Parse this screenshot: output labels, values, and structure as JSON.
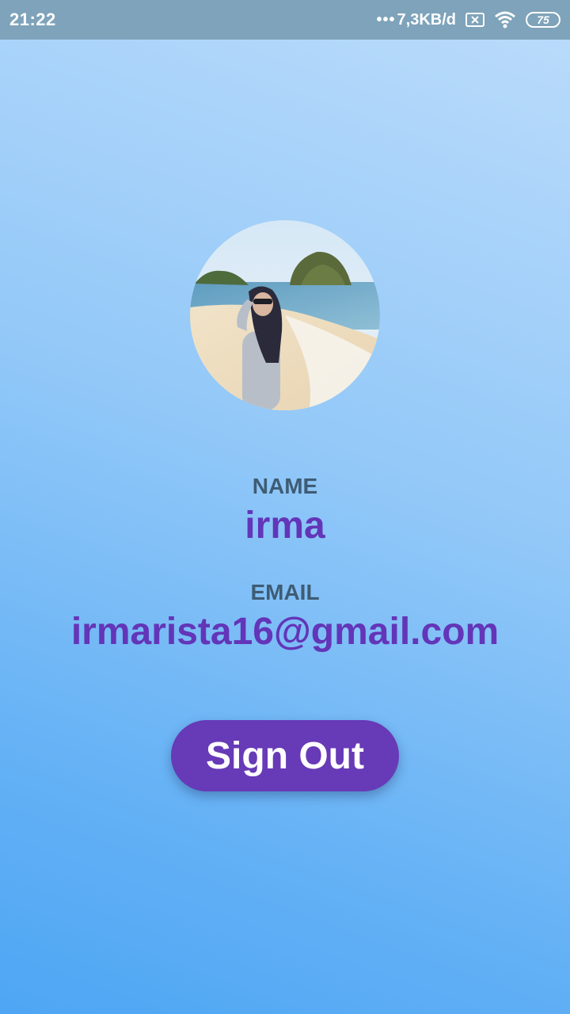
{
  "status_bar": {
    "time": "21:22",
    "dots": "•••",
    "network_speed": "7,3KB/d",
    "battery_level": "75",
    "icons": [
      "sim-off-icon",
      "wifi-icon",
      "battery-icon"
    ]
  },
  "profile": {
    "avatar_description": "profile-photo",
    "name_label": "NAME",
    "name_value": "irma",
    "email_label": "EMAIL",
    "email_value": "irmarista16@gmail.com"
  },
  "actions": {
    "sign_out_label": "Sign Out"
  },
  "colors": {
    "accent": "#673ab7",
    "value_text": "#6335b8",
    "label_text": "#3e5c74",
    "status_bar": "#7ea3ba",
    "background_top": "#bcdcfb",
    "background_bottom": "#4ea6f4"
  }
}
